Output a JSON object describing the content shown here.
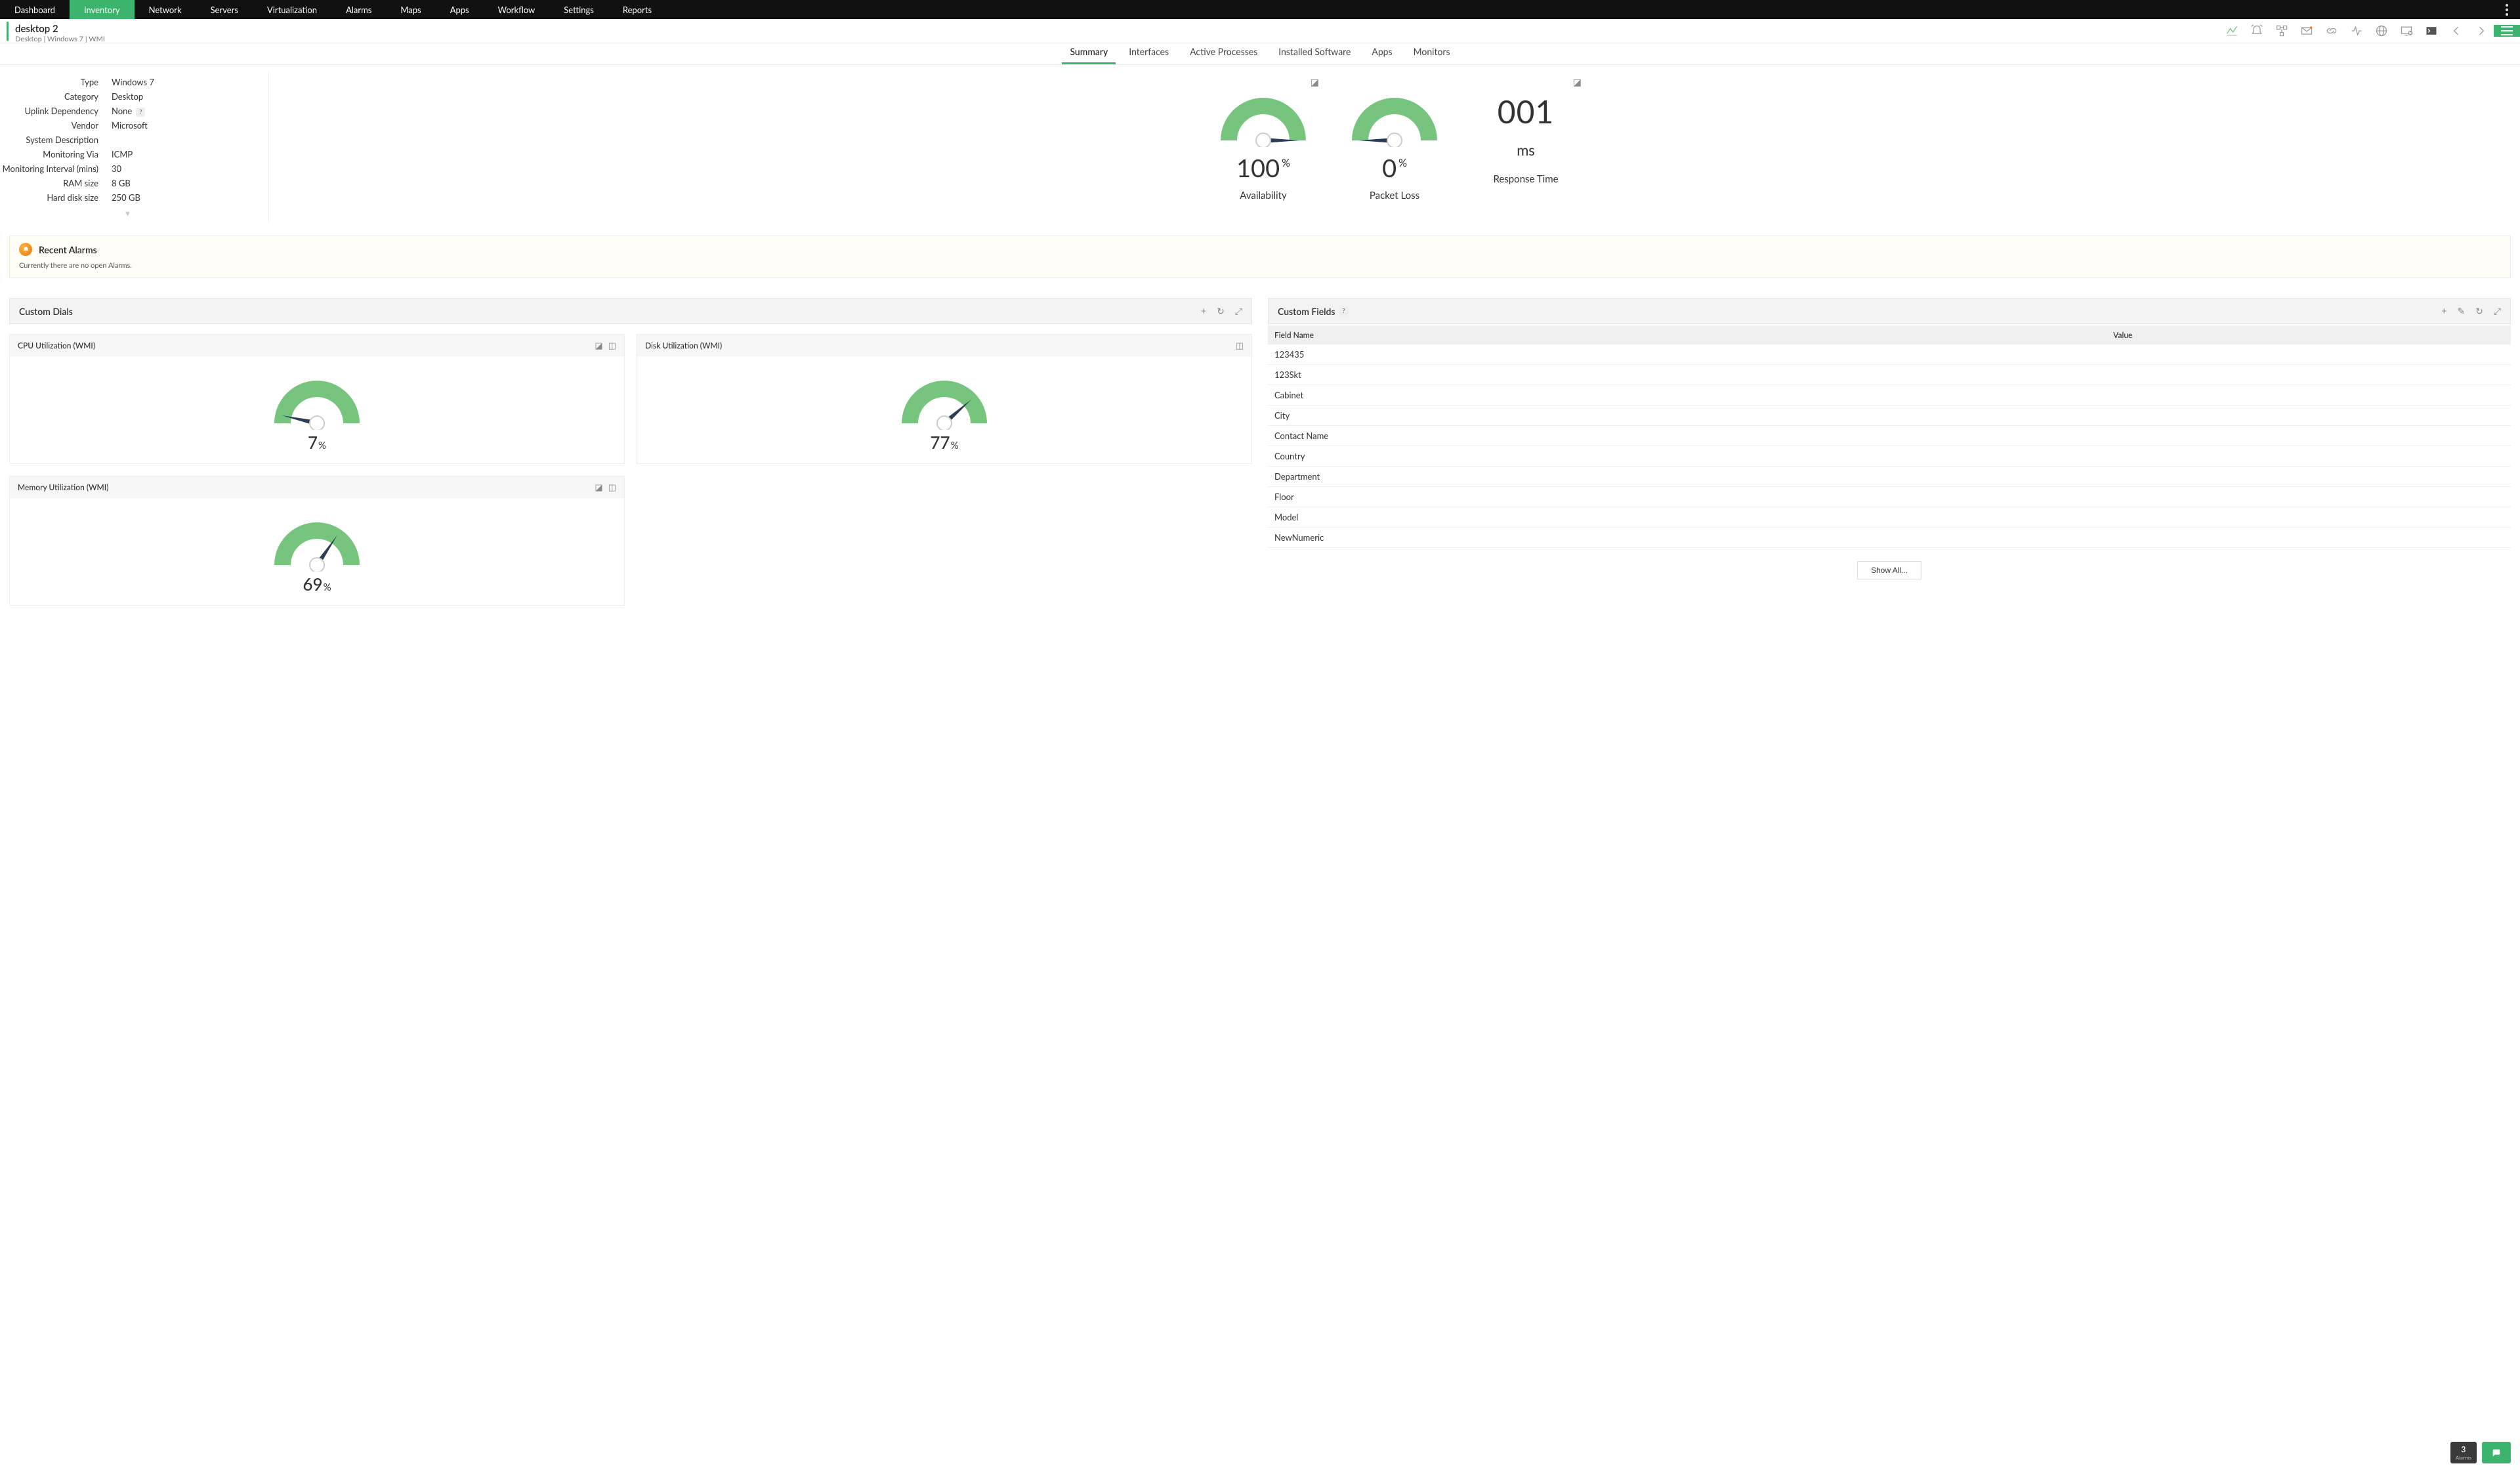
{
  "nav": {
    "items": [
      "Dashboard",
      "Inventory",
      "Network",
      "Servers",
      "Virtualization",
      "Alarms",
      "Maps",
      "Apps",
      "Workflow",
      "Settings",
      "Reports"
    ],
    "active_index": 1
  },
  "device": {
    "title": "desktop 2",
    "breadcrumb": "Desktop  | Windows 7  | WMI"
  },
  "tabs": {
    "items": [
      "Summary",
      "Interfaces",
      "Active Processes",
      "Installed Software",
      "Apps",
      "Monitors"
    ],
    "active_index": 0
  },
  "properties": [
    {
      "label": "Type",
      "value": "Windows 7"
    },
    {
      "label": "Category",
      "value": "Desktop"
    },
    {
      "label": "Uplink Dependency",
      "value": "None",
      "help": true
    },
    {
      "label": "Vendor",
      "value": "Microsoft"
    },
    {
      "label": "System Description",
      "value": ""
    },
    {
      "label": "Monitoring Via",
      "value": "ICMP"
    },
    {
      "label": "Monitoring Interval (mins)",
      "value": "30"
    },
    {
      "label": "RAM size",
      "value": "8 GB"
    },
    {
      "label": "Hard disk size",
      "value": "250 GB"
    }
  ],
  "kpi": {
    "availability": {
      "value": "100",
      "unit": "%",
      "label": "Availability",
      "gauge_pct": 100
    },
    "packet_loss": {
      "value": "0",
      "unit": "%",
      "label": "Packet Loss",
      "gauge_pct": 0
    },
    "response_time": {
      "value": "001",
      "unit": "ms",
      "label": "Response Time"
    }
  },
  "alarms": {
    "title": "Recent Alarms",
    "body": "Currently there are no open Alarms."
  },
  "custom_dials": {
    "title": "Custom Dials",
    "dials": [
      {
        "title": "CPU Utilization (WMI)",
        "value": "7",
        "pct": 7,
        "icons": [
          "threshold",
          "chart"
        ]
      },
      {
        "title": "Disk Utilization (WMI)",
        "value": "77",
        "pct": 77,
        "icons": [
          "chart"
        ]
      },
      {
        "title": "Memory Utilization (WMI)",
        "value": "69",
        "pct": 69,
        "icons": [
          "threshold",
          "chart"
        ]
      }
    ]
  },
  "custom_fields": {
    "title": "Custom Fields",
    "headers": [
      "Field Name",
      "Value"
    ],
    "rows": [
      {
        "name": "123435",
        "value": ""
      },
      {
        "name": "123Skt",
        "value": ""
      },
      {
        "name": "Cabinet",
        "value": ""
      },
      {
        "name": "City",
        "value": ""
      },
      {
        "name": "Contact Name",
        "value": ""
      },
      {
        "name": "Country",
        "value": ""
      },
      {
        "name": "Department",
        "value": ""
      },
      {
        "name": "Floor",
        "value": ""
      },
      {
        "name": "Model",
        "value": ""
      },
      {
        "name": "NewNumeric",
        "value": ""
      }
    ],
    "show_all_label": "Show All..."
  },
  "footer": {
    "alarm_count": "3",
    "alarm_label": "Alarms"
  },
  "chart_data": [
    {
      "type": "gauge",
      "title": "Availability",
      "value": 100,
      "unit": "%",
      "min": 0,
      "max": 100
    },
    {
      "type": "gauge",
      "title": "Packet Loss",
      "value": 0,
      "unit": "%",
      "min": 0,
      "max": 100
    },
    {
      "type": "gauge",
      "title": "CPU Utilization (WMI)",
      "value": 7,
      "unit": "%",
      "min": 0,
      "max": 100
    },
    {
      "type": "gauge",
      "title": "Disk Utilization (WMI)",
      "value": 77,
      "unit": "%",
      "min": 0,
      "max": 100
    },
    {
      "type": "gauge",
      "title": "Memory Utilization (WMI)",
      "value": 69,
      "unit": "%",
      "min": 0,
      "max": 100
    }
  ]
}
